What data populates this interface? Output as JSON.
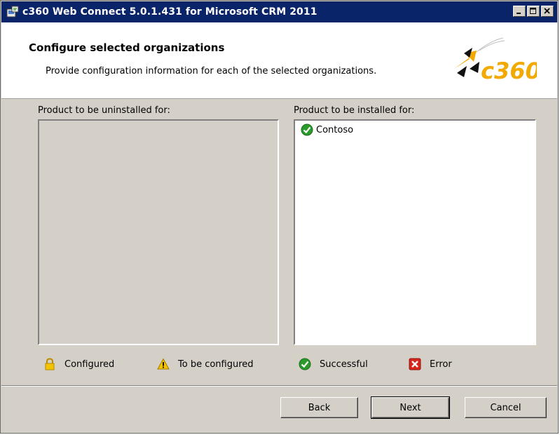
{
  "window": {
    "title": "c360 Web Connect 5.0.1.431 for Microsoft CRM 2011"
  },
  "header": {
    "title": "Configure selected organizations",
    "description": "Provide configuration information for each of the selected organizations.",
    "logo_text": "c360"
  },
  "lists": {
    "uninstall_label": "Product to be uninstalled for:",
    "install_label": "Product to be installed for:",
    "install_items": [
      {
        "label": "Contoso",
        "status_icon": "success-check-icon"
      }
    ]
  },
  "legend": {
    "items": [
      {
        "label": "Configured",
        "icon": "lock-icon"
      },
      {
        "label": "To be configured",
        "icon": "warning-icon"
      },
      {
        "label": "Successful",
        "icon": "success-check-icon"
      },
      {
        "label": "Error",
        "icon": "error-x-icon"
      }
    ]
  },
  "buttons": {
    "back": "Back",
    "next": "Next",
    "cancel": "Cancel"
  },
  "colors": {
    "titlebar": "#0a246a",
    "dialog_face": "#d4d0c8",
    "success": "#2a9a2a",
    "warning": "#f5c400",
    "error": "#d9261c",
    "logo_orange": "#f2a900"
  }
}
